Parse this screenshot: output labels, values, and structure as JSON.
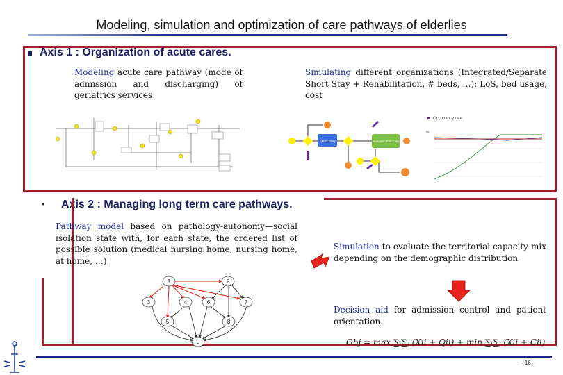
{
  "slide": {
    "title": "Modeling, simulation and optimization of care pathways of elderlies",
    "page_number": "- 16 -"
  },
  "axis1": {
    "heading": "Axis 1 : Organization of acute cares.",
    "left_text_highlight": "Modeling",
    "left_text_rest": " acute care pathway (mode of admission and discharging) of geriatrics services",
    "right_text_highlight": "Simulating",
    "right_text_rest": " different organizations (Integrated/Separate Short Stay + Rehabilitation, # beds, …): LoS, bed usage, cost",
    "flow": {
      "short_stay": "Short Stay",
      "rehab": "Rehabilitative Care"
    },
    "chart": {
      "title": "Occupancy rate",
      "ylabel": "%"
    }
  },
  "axis2": {
    "heading": "Axis 2 : Managing long term care pathways.",
    "left_text_highlight": "Pathway model",
    "left_text_rest": " based on pathology-autonomy—social isolation state with, for each state, the ordered list of possible solution (medical nursing home, nursing home, at home, …)",
    "sim_highlight": "Simulation",
    "sim_rest": " to evaluate the territorial capacity-mix depending on the demographic distribution",
    "dec_highlight": "Decision aid",
    "dec_rest": " for admission control and patient orientation.",
    "formula": "Obj = max ∑ᵢ∑ⱼ (Xii + Qii) + min ∑ᵢ∑ⱼ (Xii + Cii)",
    "graph_nodes": [
      "1",
      "2",
      "3",
      "4",
      "6",
      "7",
      "5",
      "8",
      "9"
    ]
  },
  "colors": {
    "frame": "#a11d2e",
    "heading": "#1a2060",
    "highlight": "#1a2a9c",
    "arrow": "#e8231c"
  }
}
